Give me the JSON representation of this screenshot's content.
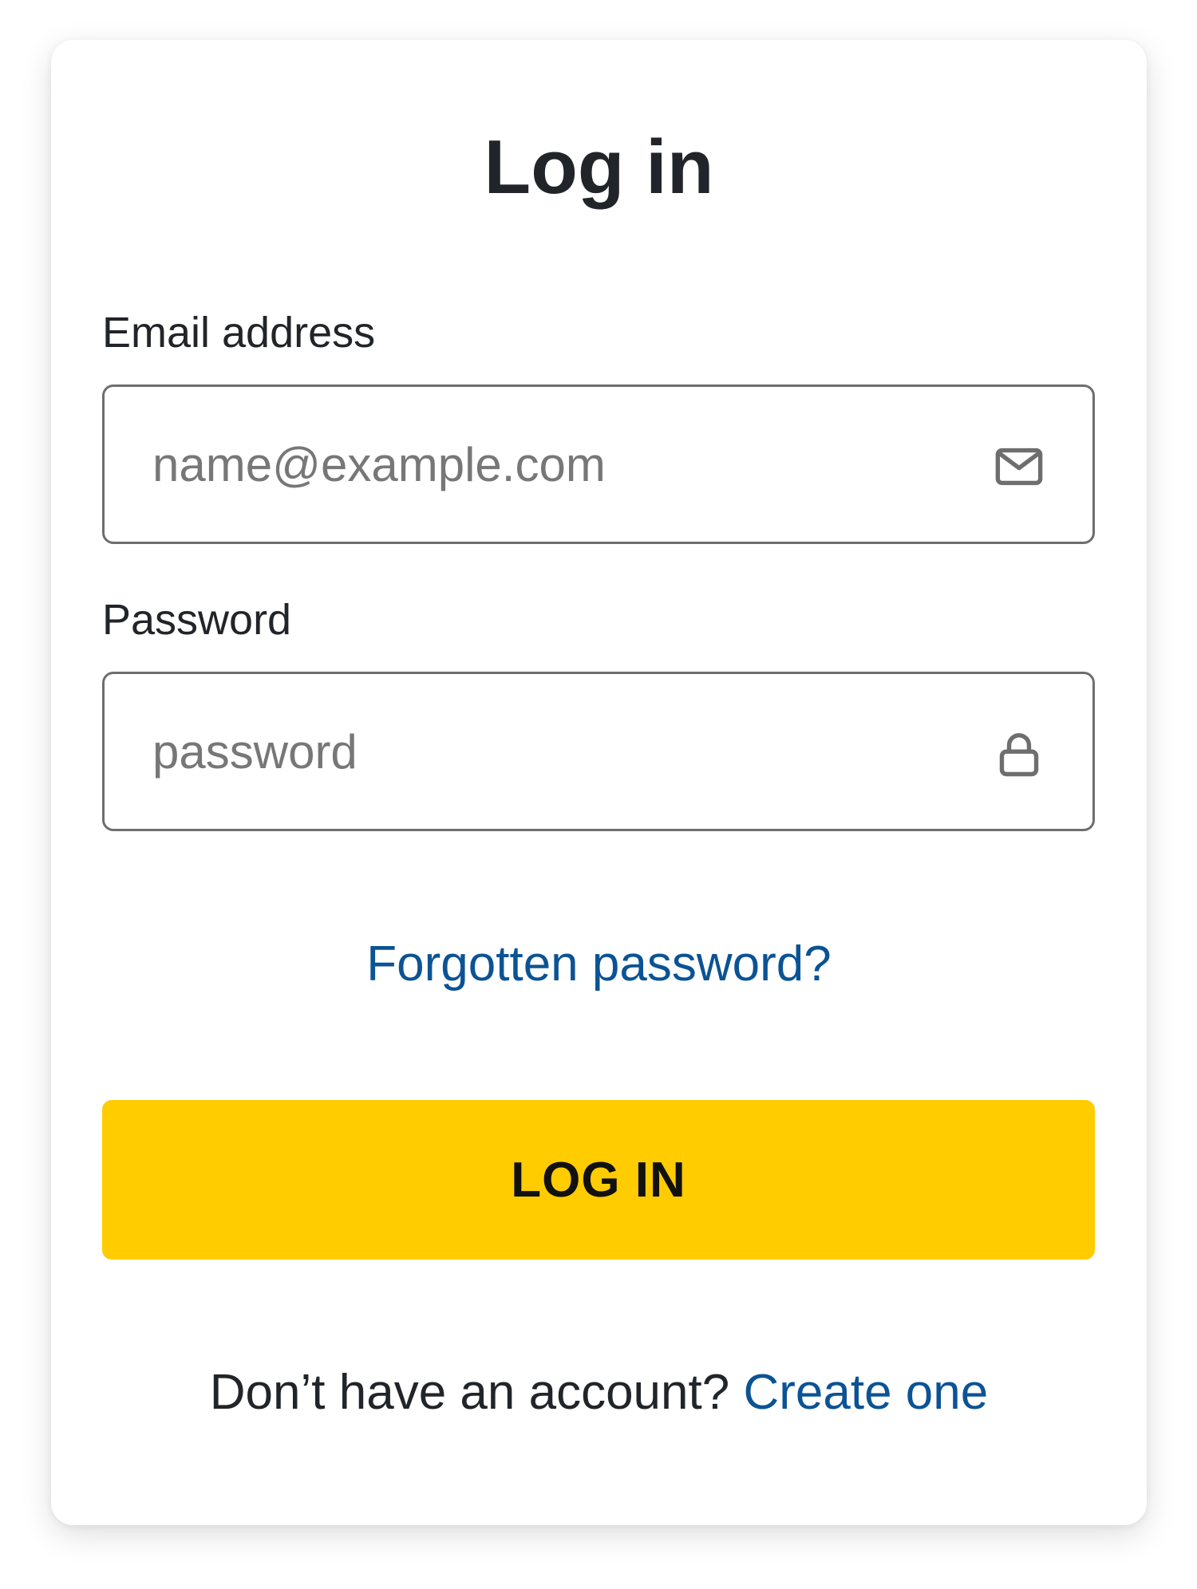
{
  "title": "Log in",
  "email": {
    "label": "Email address",
    "placeholder": "name@example.com",
    "value": "",
    "icon": "mail-icon"
  },
  "password": {
    "label": "Password",
    "placeholder": "password",
    "value": "",
    "icon": "lock-icon"
  },
  "forgot_link": "Forgotten password?",
  "login_button": "LOG IN",
  "signup": {
    "prompt": "Don’t have an account?",
    "link": "Create one"
  },
  "colors": {
    "primary_button": "#ffcc00",
    "link": "#0b5394",
    "text": "#212529",
    "input_border": "#6e6e6e",
    "placeholder": "#777777"
  }
}
